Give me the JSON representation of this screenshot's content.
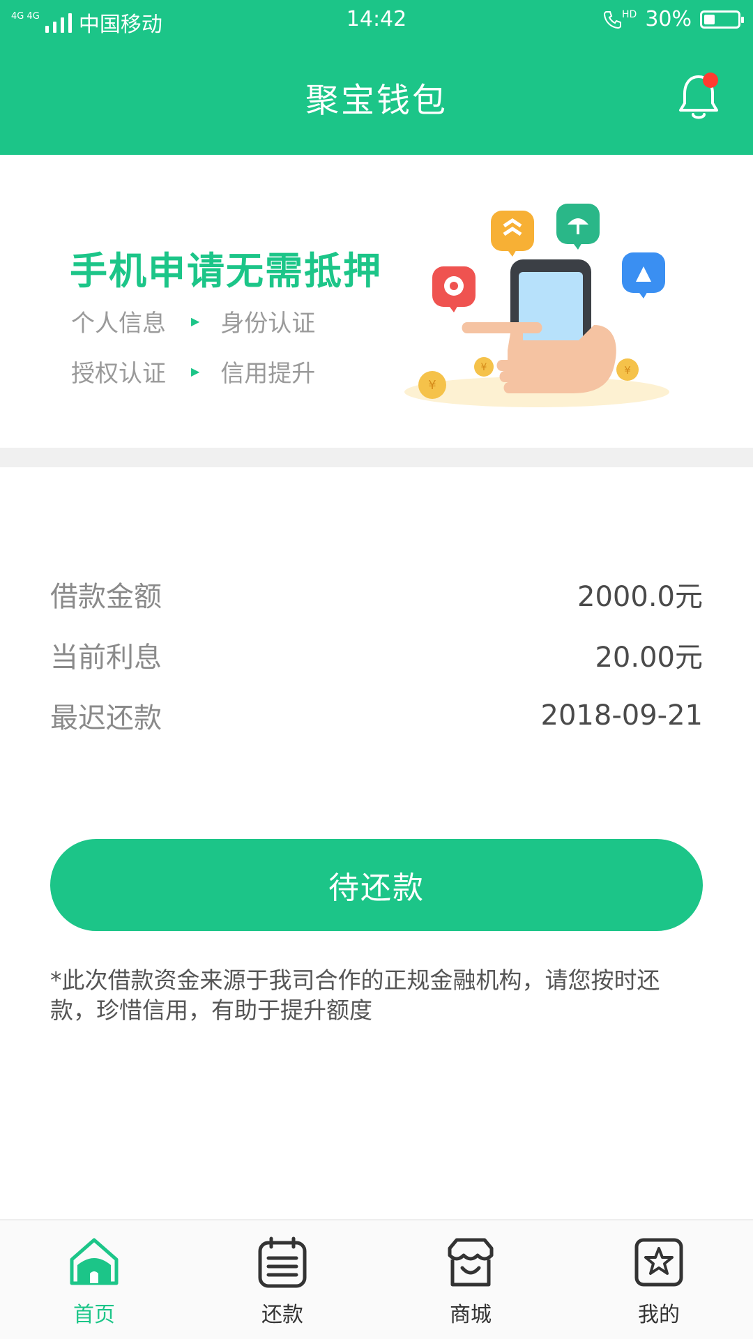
{
  "status_bar": {
    "network": "4G 4G",
    "carrier": "中国移动",
    "time": "14:42",
    "hd": "HD",
    "battery": "30%",
    "battery_level": 0.3
  },
  "header": {
    "title": "聚宝钱包"
  },
  "banner": {
    "headline": "手机申请无需抵押",
    "steps_row1": [
      "个人信息",
      "身份认证"
    ],
    "steps_row2": [
      "授权认证",
      "信用提升"
    ]
  },
  "loan": {
    "rows": [
      {
        "label": "借款金额",
        "value": "2000.0元"
      },
      {
        "label": "当前利息",
        "value": "20.00元"
      },
      {
        "label": "最迟还款",
        "value": "2018-09-21"
      }
    ],
    "button_label": "待还款",
    "notice": "*此次借款资金来源于我司合作的正规金融机构，请您按时还款，珍惜信用，有助于提升额度"
  },
  "tabs": [
    {
      "label": "首页",
      "icon": "home-icon",
      "active": true
    },
    {
      "label": "还款",
      "icon": "calendar-icon",
      "active": false
    },
    {
      "label": "商城",
      "icon": "shop-icon",
      "active": false
    },
    {
      "label": "我的",
      "icon": "star-icon",
      "active": false
    }
  ],
  "colors": {
    "brand": "#1cc588",
    "notification_dot": "#ff3b30"
  }
}
